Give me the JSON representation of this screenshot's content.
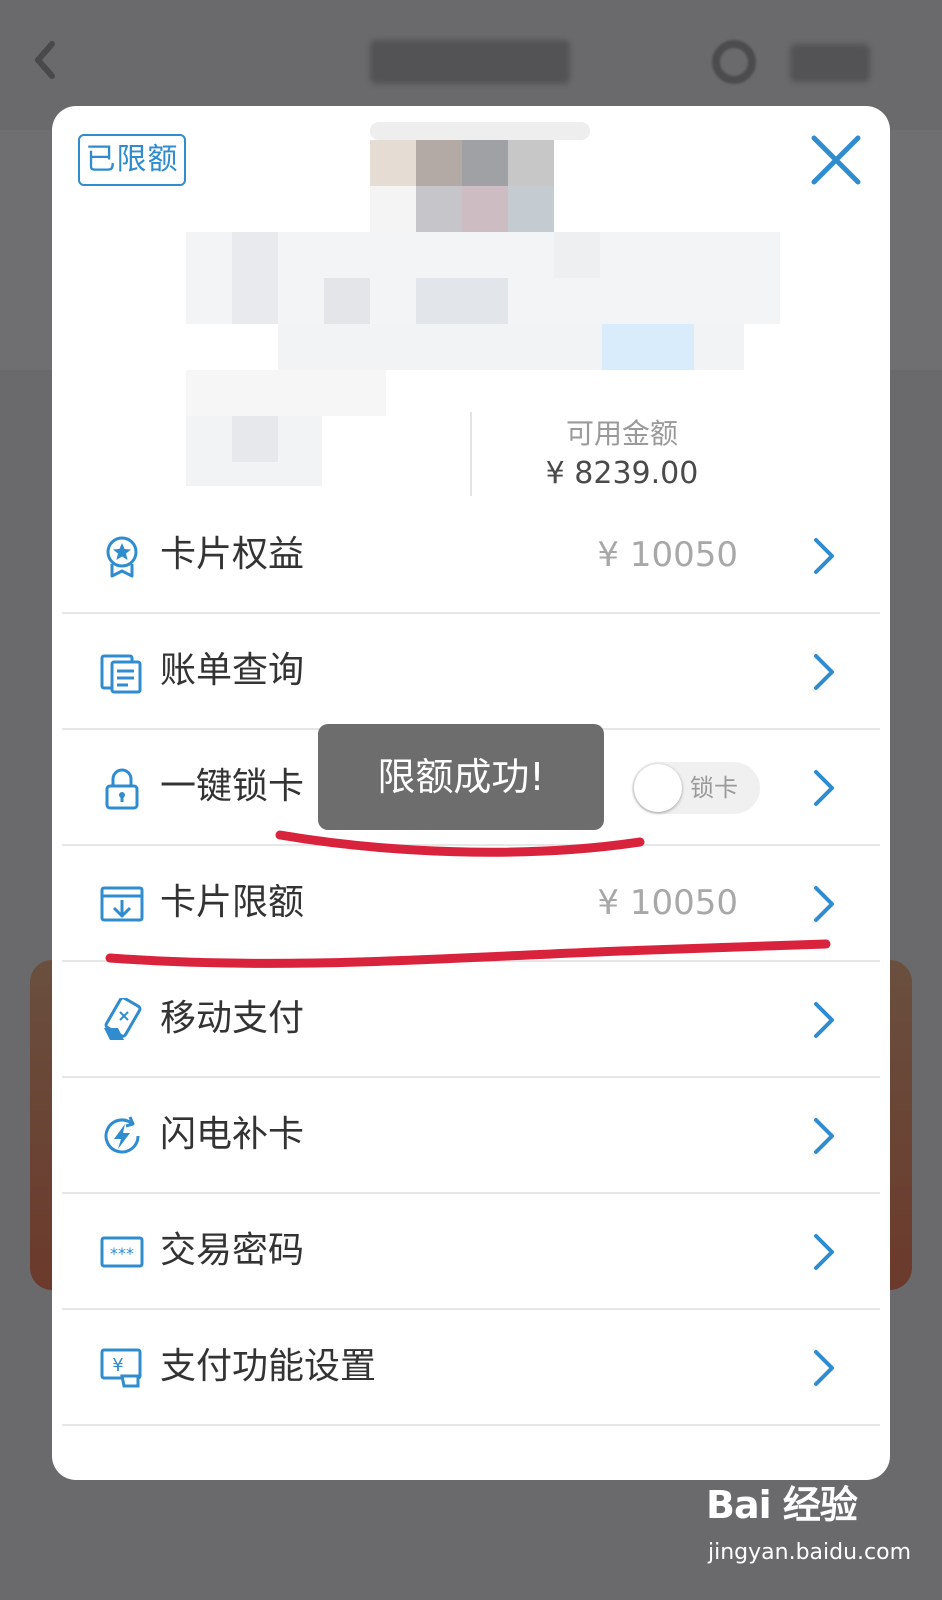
{
  "modal": {
    "badge": "已限额",
    "available_label": "可用金额",
    "available_value": "¥ 8239.00"
  },
  "rows": [
    {
      "label": "卡片权益",
      "value": "¥ 10050",
      "icon": "medal-icon"
    },
    {
      "label": "账单查询",
      "value": "",
      "icon": "bill-icon"
    },
    {
      "label": "一键锁卡",
      "value": "",
      "icon": "lock-icon",
      "toggle_label": "锁卡",
      "toggle_on": false
    },
    {
      "label": "卡片限额",
      "value": "¥ 10050",
      "icon": "limit-icon"
    },
    {
      "label": "移动支付",
      "value": "",
      "icon": "mobile-pay-icon"
    },
    {
      "label": "闪电补卡",
      "value": "",
      "icon": "lightning-card-icon"
    },
    {
      "label": "交易密码",
      "value": "",
      "icon": "password-icon"
    },
    {
      "label": "支付功能设置",
      "value": "",
      "icon": "payment-settings-icon"
    }
  ],
  "toast": "限额成功!",
  "watermark": {
    "logo": "Bai 经验",
    "url": "jingyan.baidu.com"
  },
  "colors": {
    "accent": "#2f8ccf",
    "markup_red": "#d9233c",
    "overlay": "#6a6a6d"
  }
}
